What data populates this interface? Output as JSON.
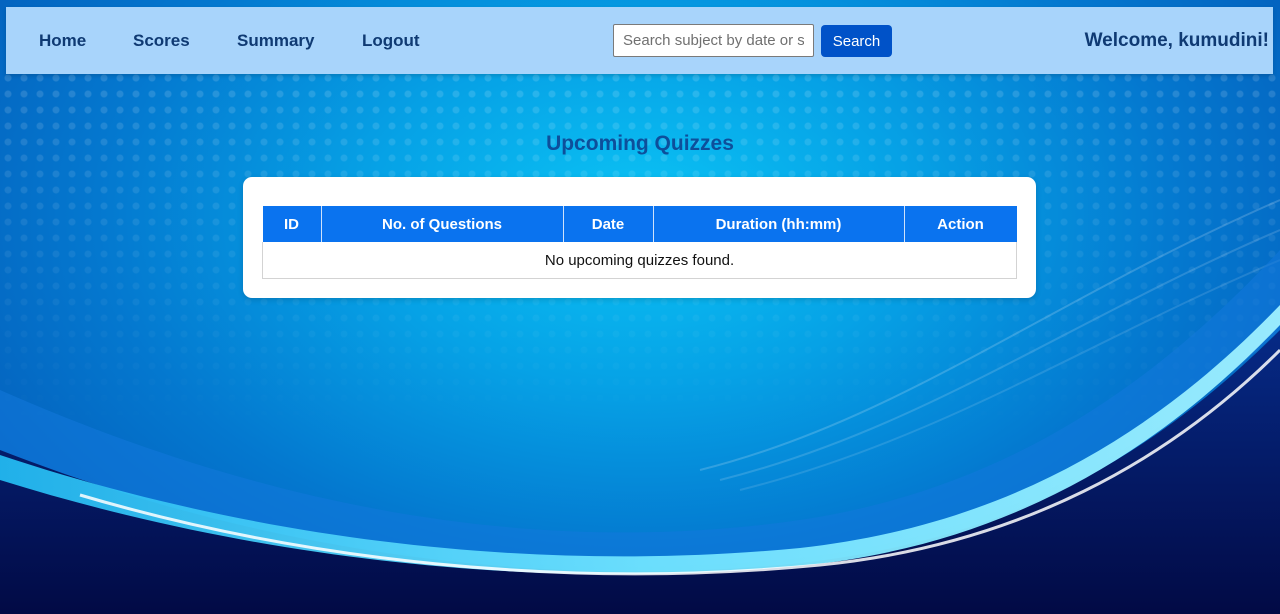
{
  "nav": {
    "links": [
      "Home",
      "Scores",
      "Summary",
      "Logout"
    ],
    "search_placeholder": "Search subject by date or s",
    "search_button": "Search",
    "welcome": "Welcome, kumudini!"
  },
  "main": {
    "title": "Upcoming Quizzes",
    "table": {
      "headers": [
        "ID",
        "No. of Questions",
        "Date",
        "Duration (hh:mm)",
        "Action"
      ],
      "empty_message": "No upcoming quizzes found."
    }
  },
  "colors": {
    "navbar": "#a8d4fb",
    "nav_text": "#0f3a73",
    "search_button": "#0052c8",
    "table_header": "#0a73ef",
    "title": "#0d4f9b"
  }
}
